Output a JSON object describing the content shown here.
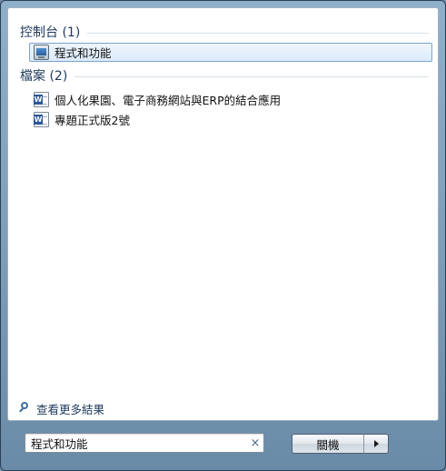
{
  "groups": [
    {
      "title": "控制台 (1)",
      "items": [
        {
          "label": "程式和功能",
          "icon": "control-panel-icon",
          "selected": true
        }
      ]
    },
    {
      "title": "檔案 (2)",
      "items": [
        {
          "label": "個人化果園、電子商務網站與ERP的結合應用",
          "icon": "word-document-icon",
          "selected": false
        },
        {
          "label": "專題正式版2號",
          "icon": "word-document-icon",
          "selected": false
        }
      ]
    }
  ],
  "see_more": {
    "label": "查看更多結果",
    "icon": "search-icon"
  },
  "search": {
    "value": "程式和功能",
    "clear_icon": "×"
  },
  "shutdown": {
    "label": "關機",
    "arrow_icon": "chevron-right-icon"
  },
  "colors": {
    "header_text": "#1e395b",
    "selection_border": "#7da2ce",
    "selection_fill": "#dcebfc"
  }
}
